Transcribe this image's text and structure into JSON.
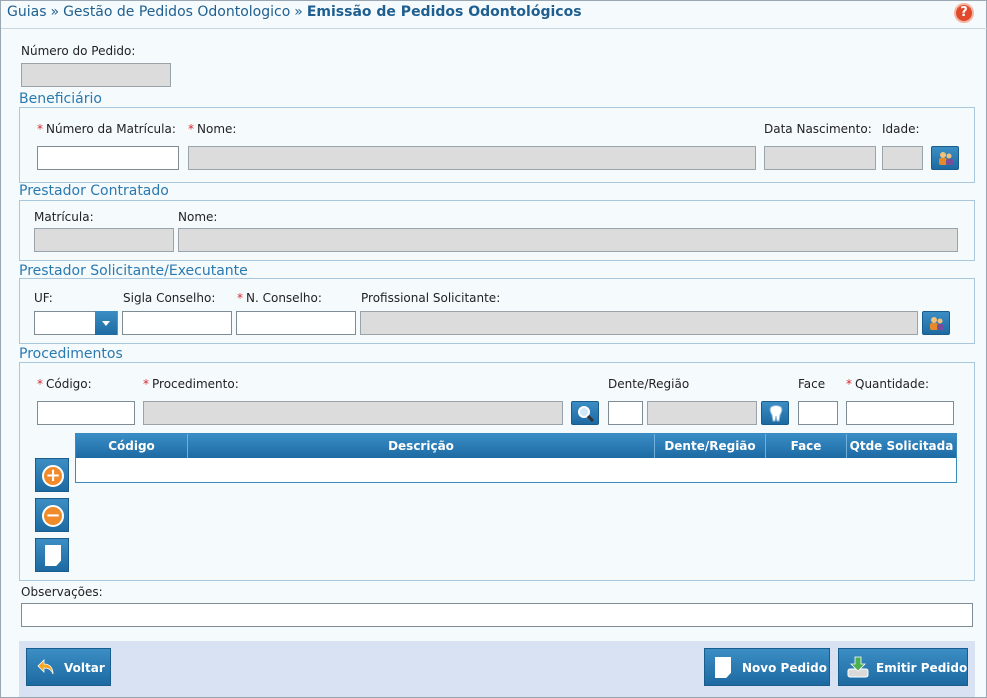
{
  "breadcrumb": {
    "item1": "Guias",
    "item2": "Gestão de Pedidos Odontologico",
    "current": "Emissão de Pedidos Odontológicos",
    "separator": "»"
  },
  "help_icon": "help-icon",
  "numero_pedido": {
    "label": "Número do Pedido:",
    "value": ""
  },
  "beneficiario": {
    "legend": "Beneficiário",
    "matricula_label": "Número da Matrícula:",
    "nome_label": "Nome:",
    "nascimento_label": "Data Nascimento:",
    "idade_label": "Idade:",
    "matricula_value": "",
    "nome_value": "",
    "nascimento_value": "",
    "idade_value": ""
  },
  "prestador_contratado": {
    "legend": "Prestador Contratado",
    "matricula_label": "Matrícula:",
    "nome_label": "Nome:"
  },
  "prestador_solicitante": {
    "legend": "Prestador Solicitante/Executante",
    "uf_label": "UF:",
    "sigla_label": "Sigla Conselho:",
    "n_conselho_label": "N. Conselho:",
    "profissional_label": "Profissional Solicitante:"
  },
  "procedimentos": {
    "legend": "Procedimentos",
    "codigo_label": "Código:",
    "procedimento_label": "Procedimento:",
    "dente_label": "Dente/Região",
    "face_label": "Face",
    "quantidade_label": "Quantidade:",
    "grid_headers": [
      "Código",
      "Descrição",
      "Dente/Região",
      "Face",
      "Qtde Solicitada"
    ]
  },
  "observacoes": {
    "label": "Observações:",
    "value": ""
  },
  "footer": {
    "voltar": "Voltar",
    "novo_pedido": "Novo Pedido",
    "emitir_pedido": "Emitir Pedido"
  },
  "required_marker": "*",
  "colors": {
    "accent": "#1d6aa2",
    "link": "#1f5f8f",
    "required": "#d8282c",
    "readonly": "#dcdcdc"
  }
}
